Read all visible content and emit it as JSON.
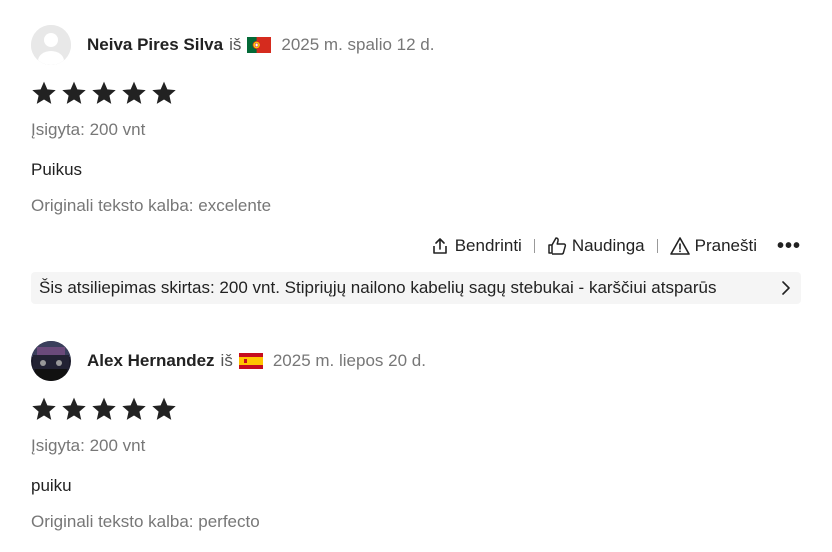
{
  "reviews": [
    {
      "name": "Neiva Pires Silva",
      "from": "iš",
      "country_flag": "portugal-flag",
      "date": "2025 m. spalio 12 d.",
      "rating": 5,
      "purchased": "Įsigyta: 200 vnt",
      "text": "Puikus",
      "original": "Originali teksto kalba: excelente",
      "actions": {
        "share": "Bendrinti",
        "helpful": "Naudinga",
        "report": "Pranešti",
        "more": "•••"
      },
      "product": "Šis atsiliepimas skirtas: 200 vnt. Stipriųjų nailono kabelių sagų stebukai - karščiui atsparūs"
    },
    {
      "name": "Alex Hernandez",
      "from": "iš",
      "country_flag": "spain-flag",
      "date": "2025 m. liepos 20 d.",
      "rating": 5,
      "purchased": "Įsigyta: 200 vnt",
      "text": "puiku",
      "original": "Originali teksto kalba: perfecto"
    }
  ],
  "colors": {
    "star": "#222222",
    "muted": "#777777",
    "bar_bg": "#f5f5f5"
  }
}
